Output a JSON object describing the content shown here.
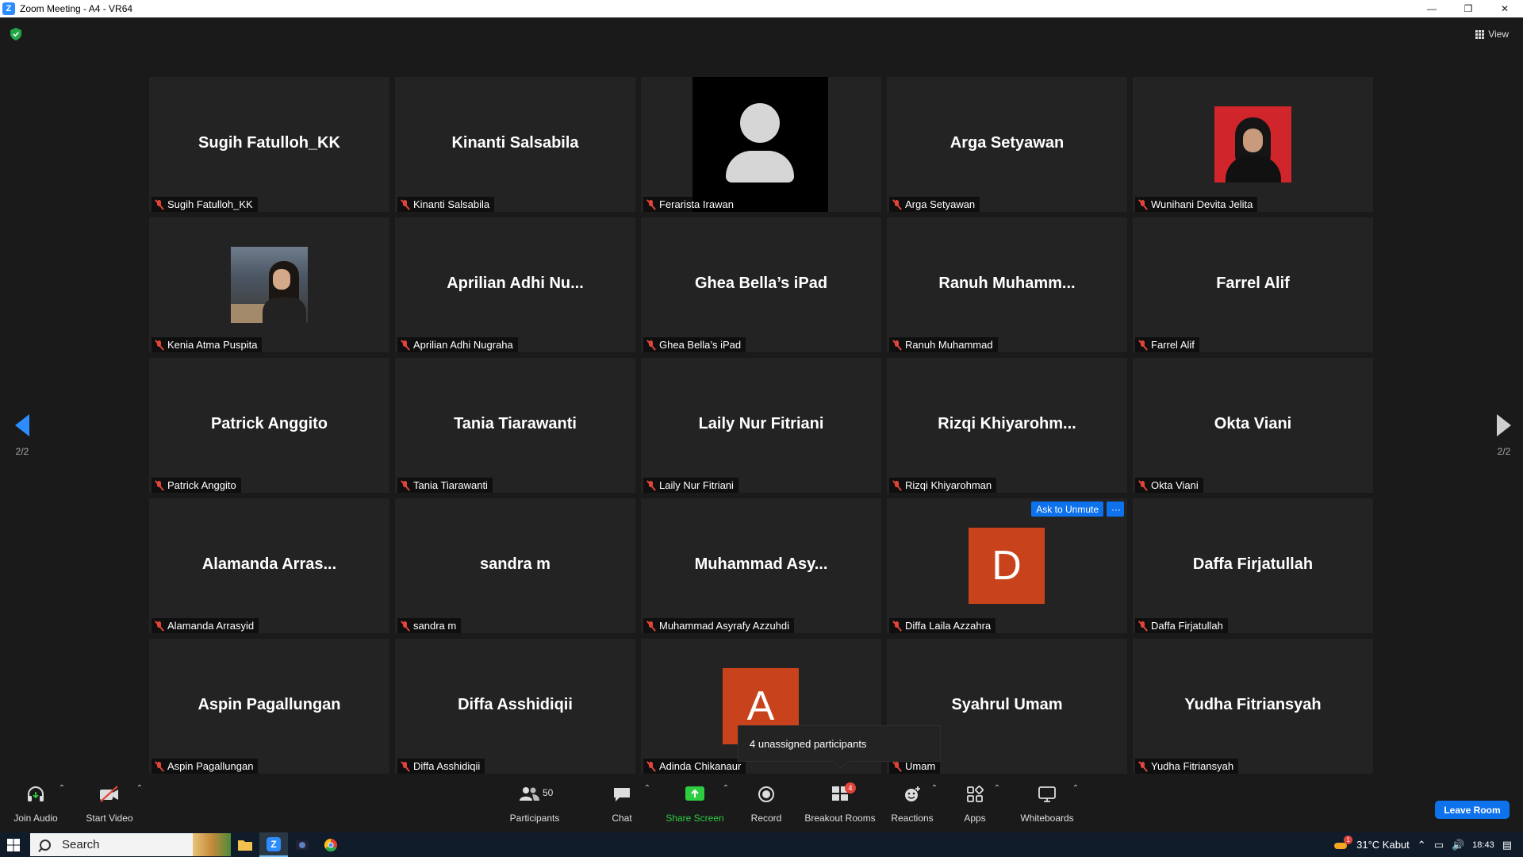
{
  "window": {
    "title": "Zoom Meeting - A4 - VR64"
  },
  "meeting": {
    "view_label": "View",
    "page_left": "2/2",
    "page_right": "2/2",
    "participants": [
      {
        "big": "Sugih Fatulloh_KK",
        "label": "Sugih Fatulloh_KK"
      },
      {
        "big": "Kinanti Salsabila",
        "label": "Kinanti Salsabila"
      },
      {
        "big": "",
        "label": "Ferarista Irawan",
        "visual": "avatar-silhouette"
      },
      {
        "big": "Arga Setyawan",
        "label": "Arga Setyawan"
      },
      {
        "big": "",
        "label": "Wunihani Devita Jelita",
        "visual": "photo-red"
      },
      {
        "big": "",
        "label": "Kenia Atma Puspita",
        "visual": "photo-room"
      },
      {
        "big": "Aprilian  Adhi  Nu...",
        "label": "Aprilian Adhi Nugraha"
      },
      {
        "big": "Ghea Bella’s iPad",
        "label": "Ghea Bella’s iPad"
      },
      {
        "big": "Ranuh  Muhamm...",
        "label": "Ranuh Muhammad"
      },
      {
        "big": "Farrel Alif",
        "label": "Farrel Alif"
      },
      {
        "big": "Patrick Anggito",
        "label": "Patrick Anggito"
      },
      {
        "big": "Tania Tiarawanti",
        "label": "Tania Tiarawanti"
      },
      {
        "big": "Laily Nur Fitriani",
        "label": "Laily Nur Fitriani"
      },
      {
        "big": "Rizqi  Khiyarohm...",
        "label": "Rizqi Khiyarohman"
      },
      {
        "big": "Okta Viani",
        "label": "Okta Viani"
      },
      {
        "big": "Alamanda  Arras...",
        "label": "Alamanda Arrasyid"
      },
      {
        "big": "sandra m",
        "label": "sandra m"
      },
      {
        "big": "Muhammad  Asy...",
        "label": "Muhammad Asyrafy Azzuhdi"
      },
      {
        "big": "",
        "label": "Diffa Laila Azzahra",
        "letter": "D",
        "ask_to_unmute": "Ask to Unmute",
        "more": "···"
      },
      {
        "big": "Daffa Firjatullah",
        "label": "Daffa Firjatullah"
      },
      {
        "big": "Aspin Pagallungan",
        "label": "Aspin Pagallungan"
      },
      {
        "big": "Diffa Asshidiqii",
        "label": "Diffa Asshidiqii"
      },
      {
        "big": "",
        "label": "Adinda Chikanaur",
        "letter": "A"
      },
      {
        "big": "Syahrul Umam",
        "label": "Umam"
      },
      {
        "big": "Yudha Fitriansyah",
        "label": "Yudha Fitriansyah"
      }
    ],
    "tooltip": "4 unassigned participants"
  },
  "toolbar": {
    "join_audio": "Join Audio",
    "start_video": "Start Video",
    "participants": "Participants",
    "participants_count": "50",
    "chat": "Chat",
    "share_screen": "Share Screen",
    "record": "Record",
    "breakout_rooms": "Breakout Rooms",
    "breakout_badge": "4",
    "reactions": "Reactions",
    "apps": "Apps",
    "whiteboards": "Whiteboards",
    "leave_room": "Leave Room"
  },
  "taskbar": {
    "search": "Search",
    "weather": "31°C  Kabut",
    "weather_badge": "1",
    "time": "18:43"
  },
  "colors": {
    "accent": "#0e72ed",
    "mute_red": "#e0453a",
    "share_green": "#2ecc40",
    "avatar_orange": "#c8431b"
  }
}
